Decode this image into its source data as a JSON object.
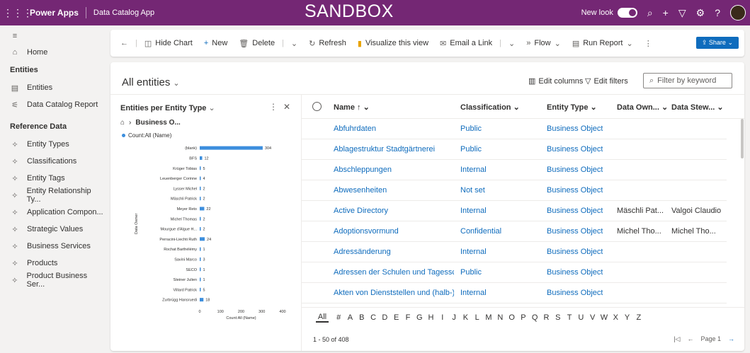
{
  "topbar": {
    "waffle_icon": "waffle-icon",
    "brand": "Power Apps",
    "app_name": "Data Catalog App",
    "environment": "SANDBOX",
    "new_look_label": "New look",
    "icons": [
      "search-icon",
      "plus-icon",
      "filter-icon",
      "settings-icon",
      "help-icon",
      "avatar"
    ]
  },
  "sidebar": {
    "home": "Home",
    "section_entities": "Entities",
    "entities_items": [
      {
        "icon": "document-icon",
        "label": "Entities"
      },
      {
        "icon": "hierarchy-icon",
        "label": "Data Catalog Report"
      }
    ],
    "section_reference": "Reference Data",
    "reference_items": [
      {
        "icon": "puzzle-icon",
        "label": "Entity Types"
      },
      {
        "icon": "puzzle-icon",
        "label": "Classifications"
      },
      {
        "icon": "puzzle-icon",
        "label": "Entity Tags"
      },
      {
        "icon": "puzzle-icon",
        "label": "Entity Relationship Ty..."
      },
      {
        "icon": "puzzle-icon",
        "label": "Application Compon..."
      },
      {
        "icon": "puzzle-icon",
        "label": "Strategic Values"
      },
      {
        "icon": "puzzle-icon",
        "label": "Business Services"
      },
      {
        "icon": "puzzle-icon",
        "label": "Products"
      },
      {
        "icon": "puzzle-icon",
        "label": "Product Business Ser..."
      }
    ]
  },
  "commandbar": {
    "hide_chart": "Hide Chart",
    "new": "New",
    "delete": "Delete",
    "refresh": "Refresh",
    "visualize": "Visualize this view",
    "email_link": "Email a Link",
    "flow": "Flow",
    "run_report": "Run Report",
    "share": "Share"
  },
  "view": {
    "title": "All entities",
    "edit_columns": "Edit columns",
    "edit_filters": "Edit filters",
    "filter_placeholder": "Filter by keyword"
  },
  "chart_panel": {
    "title": "Entities per Entity Type",
    "breadcrumb": "Business O...",
    "legend": "Count:All (Name)"
  },
  "chart_data": {
    "type": "bar",
    "orientation": "horizontal",
    "categories": [
      "(blank)",
      "BFS",
      "Krüger Tobias",
      "Leuenberger Corinne",
      "Lysser Michel",
      "Mäschli Patrick",
      "Meyer Reto",
      "Michel Thomas",
      "Mourgue d'Algue H...",
      "Perracini-Liechti Ruth",
      "Rochat Barthélémy",
      "Savini Marco",
      "SECO",
      "Steiner Julien",
      "Villard Patrick",
      "Zurbrügg Hansruedi"
    ],
    "values": [
      304,
      12,
      5,
      4,
      2,
      2,
      22,
      2,
      2,
      24,
      1,
      3,
      1,
      1,
      5,
      18
    ],
    "series": [
      {
        "name": "Count:All (Name)",
        "values": [
          304,
          12,
          5,
          4,
          2,
          2,
          22,
          2,
          2,
          24,
          1,
          3,
          1,
          1,
          5,
          18
        ]
      }
    ],
    "xlabel": "Count:All (Name)",
    "ylabel": "Data Owner",
    "xlim": [
      0,
      400
    ],
    "xticks": [
      "0",
      "100",
      "200",
      "300",
      "400"
    ],
    "color": "#3c8edd"
  },
  "grid": {
    "columns": [
      "Name ↑ ⌄",
      "Classification ⌄",
      "Entity Type ⌄",
      "Data Own... ⌄",
      "Data Stew... ⌄"
    ],
    "rows": [
      {
        "name": "Abfuhrdaten",
        "classification": "Public",
        "entity_type": "Business Object",
        "owner": "",
        "steward": ""
      },
      {
        "name": "Ablagestruktur Stadtgärtnerei",
        "classification": "Public",
        "entity_type": "Business Object",
        "owner": "",
        "steward": ""
      },
      {
        "name": "Abschleppungen",
        "classification": "Internal",
        "entity_type": "Business Object",
        "owner": "",
        "steward": ""
      },
      {
        "name": "Abwesenheiten",
        "classification": "Not set",
        "entity_type": "Business Object",
        "owner": "",
        "steward": ""
      },
      {
        "name": "Active Directory",
        "classification": "Internal",
        "entity_type": "Business Object",
        "owner": "Mäschli Pat...",
        "steward": "Valgoi Claudio"
      },
      {
        "name": "Adoptionsvormund",
        "classification": "Confidential",
        "entity_type": "Business Object",
        "owner": "Michel Tho...",
        "steward": "Michel Tho..."
      },
      {
        "name": "Adressänderung",
        "classification": "Internal",
        "entity_type": "Business Object",
        "owner": "",
        "steward": ""
      },
      {
        "name": "Adressen der Schulen und Tagessch...",
        "classification": "Public",
        "entity_type": "Business Object",
        "owner": "",
        "steward": ""
      },
      {
        "name": "Akten von Dienststellen und (halb-)...",
        "classification": "Internal",
        "entity_type": "Business Object",
        "owner": "",
        "steward": ""
      }
    ]
  },
  "alphabet": [
    "All",
    "#",
    "A",
    "B",
    "C",
    "D",
    "E",
    "F",
    "G",
    "H",
    "I",
    "J",
    "K",
    "L",
    "M",
    "N",
    "O",
    "P",
    "Q",
    "R",
    "S",
    "T",
    "U",
    "V",
    "W",
    "X",
    "Y",
    "Z"
  ],
  "footer": {
    "count": "1 - 50 of 408",
    "page": "Page 1"
  }
}
